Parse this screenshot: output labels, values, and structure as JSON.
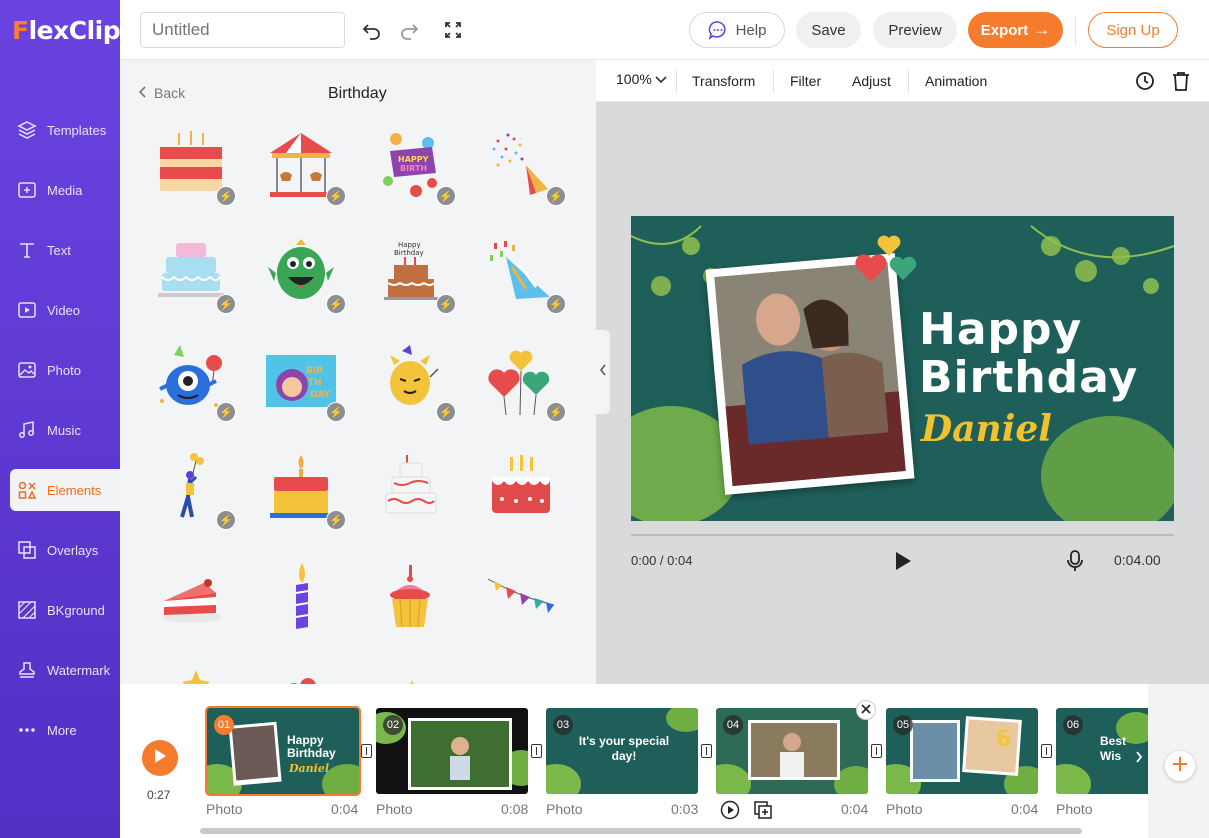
{
  "app": {
    "logo": "FlexClip"
  },
  "sidebar": {
    "items": [
      {
        "label": "Templates",
        "icon": "layers-icon"
      },
      {
        "label": "Media",
        "icon": "media-plus-icon"
      },
      {
        "label": "Text",
        "icon": "text-icon"
      },
      {
        "label": "Video",
        "icon": "video-icon"
      },
      {
        "label": "Photo",
        "icon": "photo-icon"
      },
      {
        "label": "Music",
        "icon": "music-icon"
      },
      {
        "label": "Elements",
        "icon": "elements-icon"
      },
      {
        "label": "Overlays",
        "icon": "overlays-icon"
      },
      {
        "label": "BKground",
        "icon": "background-icon"
      },
      {
        "label": "Watermark",
        "icon": "watermark-icon"
      },
      {
        "label": "More",
        "icon": "more-dots-icon"
      }
    ],
    "active_index": 6
  },
  "topbar": {
    "title_placeholder": "Untitled",
    "help": "Help",
    "save": "Save",
    "preview": "Preview",
    "export": "Export",
    "signup": "Sign Up"
  },
  "panel": {
    "back": "Back",
    "title": "Birthday",
    "items": [
      "cake-layered",
      "carousel",
      "happy-birthday-balloons",
      "confetti-popper",
      "cake-blue",
      "green-monster",
      "cake-happy-birthday",
      "party-hat",
      "blue-monster",
      "birthday-card",
      "yellow-cat",
      "heart-balloons",
      "person-balloons",
      "cake-candle",
      "cake-white",
      "cake-red",
      "cake-slice",
      "candle-purple",
      "cupcake",
      "bunting-flags"
    ]
  },
  "toolbar": {
    "zoom": "100%",
    "transform": "Transform",
    "filter": "Filter",
    "adjust": "Adjust",
    "animation": "Animation"
  },
  "video": {
    "line1": "Happy",
    "line2": "Birthday",
    "name": "Daniel"
  },
  "player": {
    "time": "0:00 / 0:04",
    "duration": "0:04.00"
  },
  "timeline": {
    "total": "0:27",
    "clips": [
      {
        "num": "01",
        "label": "Photo",
        "dur": "0:04",
        "text": "Happy Birthday",
        "sub": "Daniel"
      },
      {
        "num": "02",
        "label": "Photo",
        "dur": "0:08",
        "text": "",
        "sub": ""
      },
      {
        "num": "03",
        "label": "Photo",
        "dur": "0:03",
        "text": "It's your special day!",
        "sub": ""
      },
      {
        "num": "04",
        "label": "",
        "dur": "0:04",
        "text": "",
        "sub": ""
      },
      {
        "num": "05",
        "label": "Photo",
        "dur": "0:04",
        "text": "",
        "sub": ""
      },
      {
        "num": "06",
        "label": "Photo",
        "dur": "",
        "text": "Best Wis",
        "sub": ""
      }
    ]
  },
  "colors": {
    "accent": "#f47c2c",
    "sidebar": "#5b3fd6",
    "video_bg": "#1f5f5a",
    "title_white": "#ffffff",
    "name_yellow": "#f2c12e"
  }
}
